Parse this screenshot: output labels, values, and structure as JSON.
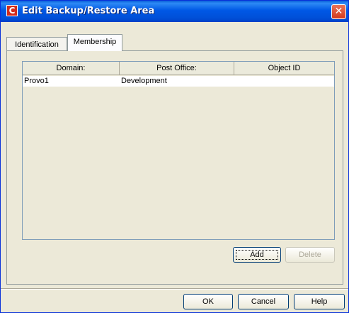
{
  "window": {
    "title": "Edit Backup/Restore Area",
    "app_icon_glyph": "C",
    "close_glyph": "✕"
  },
  "tabs": [
    {
      "label": "Identification",
      "selected": false
    },
    {
      "label": "Membership",
      "selected": true
    }
  ],
  "table": {
    "columns": [
      "Domain:",
      "Post Office:",
      "Object ID"
    ],
    "rows": [
      {
        "domain": "Provo1",
        "post_office": "Development",
        "object_id": ""
      }
    ]
  },
  "buttons": {
    "add": "Add",
    "delete": "Delete",
    "ok": "OK",
    "cancel": "Cancel",
    "help": "Help"
  },
  "colors": {
    "titlebar": "#0058e6",
    "dialog_bg": "#ece9d8",
    "close_button": "#d33a1d",
    "app_icon": "#d42c1c"
  }
}
